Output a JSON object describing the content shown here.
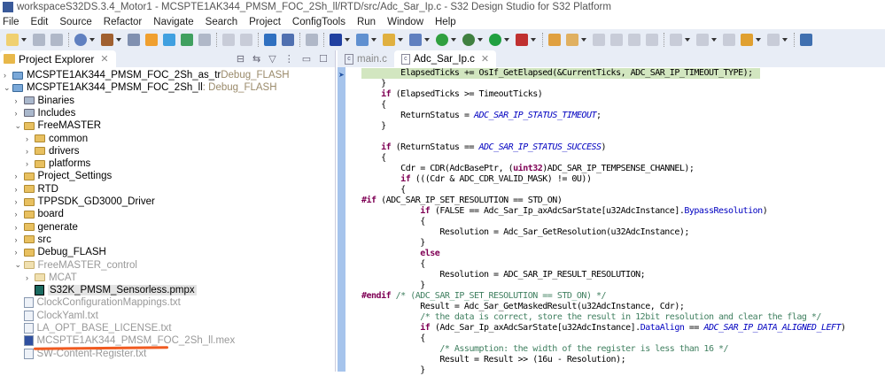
{
  "window": {
    "title": "workspaceS32DS.3.4_Motor1 - MCSPTE1AK344_PMSM_FOC_2Sh_ll/RTD/src/Adc_Sar_Ip.c - S32 Design Studio for S32 Platform",
    "logo": "S32DS"
  },
  "menu": [
    "File",
    "Edit",
    "Source",
    "Refactor",
    "Navigate",
    "Search",
    "Project",
    "ConfigTools",
    "Run",
    "Window",
    "Help"
  ],
  "toolbar": {
    "icons": [
      "new-icon",
      "save-icon",
      "save-all-icon",
      "build-config-icon",
      "build-hammer-icon",
      "binary-icon",
      "new-project-icon",
      "new-layers-icon",
      "new-class-icon",
      "file-icon",
      "undo-icon",
      "redo-icon",
      "terminal-icon",
      "skip-breakpoints-icon",
      "refresh-icon",
      "chip-icon",
      "new-c-project-icon",
      "new-folder-icon",
      "new-source-icon",
      "g-icon",
      "debug-icon",
      "run-icon",
      "external-tools-icon",
      "open-folder-icon",
      "pen-icon",
      "edit-icon",
      "copy-icon",
      "block-icon",
      "pilcrow-icon",
      "next-annotation-icon",
      "prev-annotation-icon",
      "back-edit-icon",
      "back-icon",
      "forward-icon",
      "new-window-icon"
    ]
  },
  "explorer": {
    "title": "Project Explorer",
    "items": [
      {
        "label": "MCSPTE1AK344_PMSM_FOC_2Sh_as_tr",
        "suffix": " Debug_FLASH",
        "level": 0,
        "chev": "›",
        "icon": "proj"
      },
      {
        "label": "MCSPTE1AK344_PMSM_FOC_2Sh_ll",
        "suffix": ": Debug_FLASH",
        "level": 0,
        "chev": "⌄",
        "icon": "proj"
      },
      {
        "label": "Binaries",
        "level": 1,
        "chev": "›",
        "icon": "lib"
      },
      {
        "label": "Includes",
        "level": 1,
        "chev": "›",
        "icon": "lib"
      },
      {
        "label": "FreeMASTER",
        "level": 1,
        "chev": "⌄",
        "icon": "src"
      },
      {
        "label": "common",
        "level": 2,
        "chev": "›",
        "icon": "folder"
      },
      {
        "label": "drivers",
        "level": 2,
        "chev": "›",
        "icon": "folder"
      },
      {
        "label": "platforms",
        "level": 2,
        "chev": "›",
        "icon": "folder"
      },
      {
        "label": "Project_Settings",
        "level": 1,
        "chev": "›",
        "icon": "src"
      },
      {
        "label": "RTD",
        "level": 1,
        "chev": "›",
        "icon": "src"
      },
      {
        "label": "TPPSDK_GD3000_Driver",
        "level": 1,
        "chev": "›",
        "icon": "src"
      },
      {
        "label": "board",
        "level": 1,
        "chev": "›",
        "icon": "src"
      },
      {
        "label": "generate",
        "level": 1,
        "chev": "›",
        "icon": "src"
      },
      {
        "label": "src",
        "level": 1,
        "chev": "›",
        "icon": "src"
      },
      {
        "label": "Debug_FLASH",
        "level": 1,
        "chev": "›",
        "icon": "folder"
      },
      {
        "label": "FreeMASTER_control",
        "level": 1,
        "chev": "⌄",
        "icon": "gray",
        "dim": true
      },
      {
        "label": "MCAT",
        "level": 2,
        "chev": "›",
        "icon": "gray",
        "dim": true
      },
      {
        "label": "S32K_PMSM_Sensorless.pmpx",
        "level": 2,
        "chev": "",
        "icon": "pmpx",
        "selected": true
      },
      {
        "label": "ClockConfigurationMappings.txt",
        "level": 1,
        "chev": "",
        "icon": "file",
        "dim": true
      },
      {
        "label": "ClockYaml.txt",
        "level": 1,
        "chev": "",
        "icon": "file",
        "dim": true
      },
      {
        "label": "LA_OPT_BASE_LICENSE.txt",
        "level": 1,
        "chev": "",
        "icon": "file",
        "dim": true
      },
      {
        "label": "MCSPTE1AK344_PMSM_FOC_2Sh_ll.mex",
        "level": 1,
        "chev": "",
        "icon": "mex",
        "dim": true
      },
      {
        "label": "SW-Content-Register.txt",
        "level": 1,
        "chev": "",
        "icon": "file",
        "dim": true
      }
    ]
  },
  "editor": {
    "tabs": [
      {
        "label": "main.c",
        "active": false
      },
      {
        "label": "Adc_Sar_Ip.c",
        "active": true
      }
    ],
    "lines": [
      {
        "i": 8,
        "hl": true,
        "t": [
          [
            "ElapsedTicks += OsIf_GetElapsed(&CurrentTicks, ADC_SAR_IP_TIMEOUT_TYPE);",
            ""
          ]
        ]
      },
      {
        "i": 4,
        "t": [
          [
            "}",
            ""
          ]
        ]
      },
      {
        "i": 4,
        "t": [
          [
            "if",
            "k"
          ],
          [
            " (ElapsedTicks >= TimeoutTicks)",
            ""
          ]
        ]
      },
      {
        "i": 4,
        "t": [
          [
            "{",
            ""
          ]
        ]
      },
      {
        "i": 8,
        "t": [
          [
            "ReturnStatus = ",
            ""
          ],
          [
            "ADC_SAR_IP_STATUS_TIMEOUT",
            "e"
          ],
          [
            ";",
            ""
          ]
        ]
      },
      {
        "i": 4,
        "t": [
          [
            "}",
            ""
          ]
        ]
      },
      {
        "i": 0,
        "t": []
      },
      {
        "i": 4,
        "t": [
          [
            "if",
            "k"
          ],
          [
            " (ReturnStatus == ",
            ""
          ],
          [
            "ADC_SAR_IP_STATUS_SUCCESS",
            "e"
          ],
          [
            ")",
            ""
          ]
        ]
      },
      {
        "i": 4,
        "t": [
          [
            "{",
            ""
          ]
        ]
      },
      {
        "i": 8,
        "t": [
          [
            "Cdr = CDR(AdcBasePtr, (",
            ""
          ],
          [
            "uint32",
            "k"
          ],
          [
            ")ADC_SAR_IP_TEMPSENSE_CHANNEL);",
            ""
          ]
        ]
      },
      {
        "i": 8,
        "t": [
          [
            "if",
            "k"
          ],
          [
            " (((Cdr & ADC_CDR_VALID_MASK) != 0U))",
            ""
          ]
        ]
      },
      {
        "i": 8,
        "t": [
          [
            "{",
            ""
          ]
        ]
      },
      {
        "i": 0,
        "t": [
          [
            "#if",
            "k"
          ],
          [
            " (ADC_SAR_IP_SET_RESOLUTION == STD_ON)",
            ""
          ]
        ]
      },
      {
        "i": 12,
        "t": [
          [
            "if",
            "k"
          ],
          [
            " (FALSE == Adc_Sar_Ip_axAdcSarState[u32AdcInstance].",
            ""
          ],
          [
            "BypassResolution",
            "f"
          ],
          [
            ")",
            ""
          ]
        ]
      },
      {
        "i": 12,
        "t": [
          [
            "{",
            ""
          ]
        ]
      },
      {
        "i": 16,
        "t": [
          [
            "Resolution = Adc_Sar_GetResolution(u32AdcInstance);",
            ""
          ]
        ]
      },
      {
        "i": 12,
        "t": [
          [
            "}",
            ""
          ]
        ]
      },
      {
        "i": 12,
        "t": [
          [
            "else",
            "k"
          ]
        ]
      },
      {
        "i": 12,
        "t": [
          [
            "{",
            ""
          ]
        ]
      },
      {
        "i": 16,
        "t": [
          [
            "Resolution = ADC_SAR_IP_RESULT_RESOLUTION;",
            ""
          ]
        ]
      },
      {
        "i": 12,
        "t": [
          [
            "}",
            ""
          ]
        ]
      },
      {
        "i": 0,
        "t": [
          [
            "#endif",
            "k"
          ],
          [
            " /* (ADC_SAR_IP_SET_RESOLUTION == STD_ON) */",
            "c"
          ]
        ]
      },
      {
        "i": 12,
        "t": [
          [
            "Result = Adc_Sar_GetMaskedResult(u32AdcInstance, Cdr);",
            ""
          ]
        ]
      },
      {
        "i": 12,
        "t": [
          [
            "/* the data is correct, store the result in 12bit resolution and clear the flag */",
            "c"
          ]
        ]
      },
      {
        "i": 12,
        "t": [
          [
            "if",
            "k"
          ],
          [
            " (Adc_Sar_Ip_axAdcSarState[u32AdcInstance].",
            ""
          ],
          [
            "DataAlign",
            "f"
          ],
          [
            " == ",
            ""
          ],
          [
            "ADC_SAR_IP_DATA_ALIGNED_LEFT",
            "e"
          ],
          [
            ")",
            ""
          ]
        ]
      },
      {
        "i": 12,
        "t": [
          [
            "{",
            ""
          ]
        ]
      },
      {
        "i": 16,
        "t": [
          [
            "/* Assumption: the width of the register is less than 16 */",
            "c"
          ]
        ]
      },
      {
        "i": 16,
        "t": [
          [
            "Result = Result >> (16u - Resolution);",
            ""
          ]
        ]
      },
      {
        "i": 12,
        "t": [
          [
            "}",
            ""
          ]
        ]
      }
    ]
  }
}
